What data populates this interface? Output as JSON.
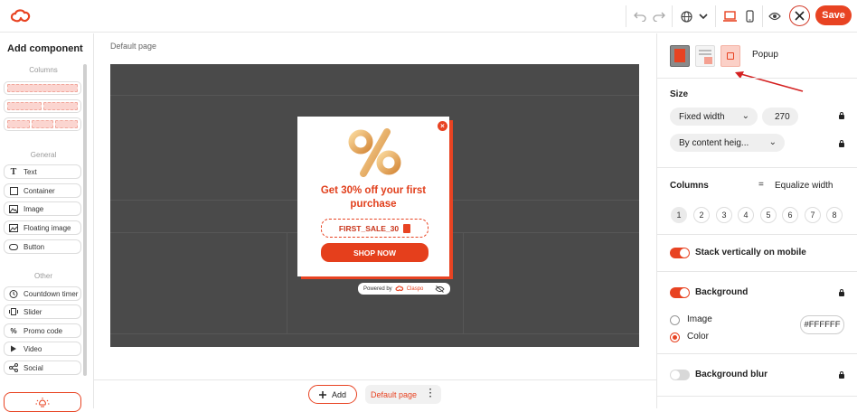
{
  "topbar": {
    "logo_icon": "claspo-logo-icon",
    "undo_icon": "undo-icon",
    "redo_icon": "redo-icon",
    "language_icon": "globe-icon",
    "desktop_icon": "laptop-icon",
    "mobile_icon": "phone-icon",
    "preview_icon": "eye-icon",
    "close_icon": "close-icon",
    "save_label": "Save"
  },
  "left_panel": {
    "title": "Add component",
    "columns_label": "Columns",
    "general_label": "General",
    "general_items": [
      {
        "label": "Text",
        "icon": "text-icon"
      },
      {
        "label": "Container",
        "icon": "container-icon"
      },
      {
        "label": "Image",
        "icon": "image-icon"
      },
      {
        "label": "Floating image",
        "icon": "floating-image-icon"
      },
      {
        "label": "Button",
        "icon": "button-icon"
      }
    ],
    "other_label": "Other",
    "other_items": [
      {
        "label": "Countdown timer",
        "icon": "timer-icon"
      },
      {
        "label": "Slider",
        "icon": "slider-icon"
      },
      {
        "label": "Promo code",
        "icon": "percent-icon"
      },
      {
        "label": "Video",
        "icon": "play-icon"
      },
      {
        "label": "Social",
        "icon": "share-icon"
      }
    ]
  },
  "canvas": {
    "page_label": "Default page",
    "popup": {
      "title": "Get 30% off your first purchase",
      "coupon_code": "FIRST_SALE_30",
      "button_label": "SHOP NOW",
      "powered_by": "Powered by",
      "brand": "Claspo"
    }
  },
  "bottombar": {
    "add_label": "Add",
    "page_tab": "Default page"
  },
  "right_panel": {
    "layout_label": "Popup",
    "size_label": "Size",
    "width_mode": "Fixed width",
    "width_value": "270",
    "height_mode": "By content heig...",
    "columns_label": "Columns",
    "equalize_label": "Equalize width",
    "column_options": [
      "1",
      "2",
      "3",
      "4",
      "5",
      "6",
      "7",
      "8"
    ],
    "selected_columns": "1",
    "stack_label": "Stack vertically on mobile",
    "stack_on": true,
    "background_label": "Background",
    "background_on": true,
    "bg_options": [
      "Image",
      "Color"
    ],
    "bg_selected": "Color",
    "bg_color": "#FFFFFF",
    "blur_label": "Background blur",
    "blur_on": false
  },
  "colors": {
    "accent": "#e84322",
    "stage": "#4a4a4a"
  }
}
